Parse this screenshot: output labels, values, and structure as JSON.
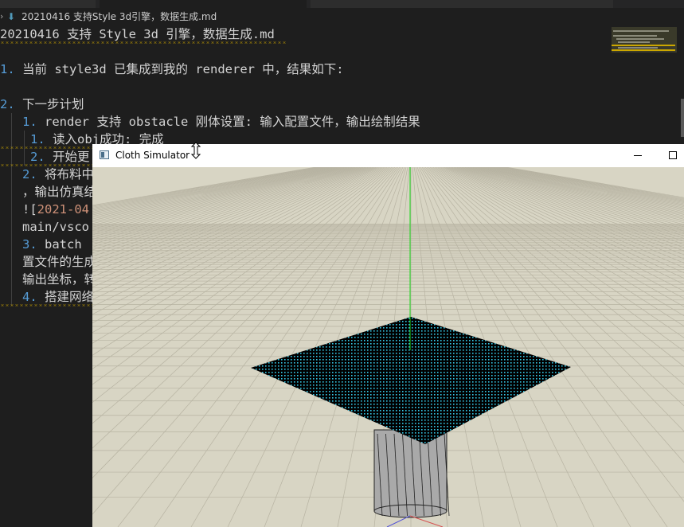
{
  "breadcrumb": {
    "file": "20210416 支持Style 3d引擎，数据生成.md"
  },
  "editor": {
    "title_line": "20210416 支持 Style 3d 引擎，数据生成.md",
    "item1": {
      "num": "1.",
      "text": " 当前 style3d 已集成到我的 renderer 中，结果如下:"
    },
    "item2": {
      "num": "2.",
      "text": " 下一步计划"
    },
    "sub1": {
      "num": "1.",
      "text": " render 支持 obstacle 刚体设置: 输入配置文件，输出绘制结果"
    },
    "sub1a": {
      "num": "1.",
      "text": " 读入obj成功: 完成"
    },
    "sub1b": {
      "num": "2.",
      "text": " 开始更"
    },
    "sub2": {
      "num": "2.",
      "text": " 将布料中"
    },
    "sub2_cont": "，输出仿真结",
    "img_link_open": "![",
    "img_link_text": "2021-04",
    "img_path": "main/vsco",
    "sub3": {
      "num": "3.",
      "text": " batch"
    },
    "sub3_cont1": "置文件的生成",
    "sub3_cont2": "输出坐标，转",
    "sub4": {
      "num": "4.",
      "text": " 搭建网络"
    }
  },
  "simulator": {
    "title": "Cloth Simulator",
    "colors": {
      "cloth_dots": "#35c7e6",
      "ground": "#d8d5c4",
      "grid": "#b7b3a2",
      "y_axis": "#19d619",
      "x_axis": "#d65050",
      "z_axis": "#5050d6",
      "cylinder": "#a9a9a9"
    }
  }
}
